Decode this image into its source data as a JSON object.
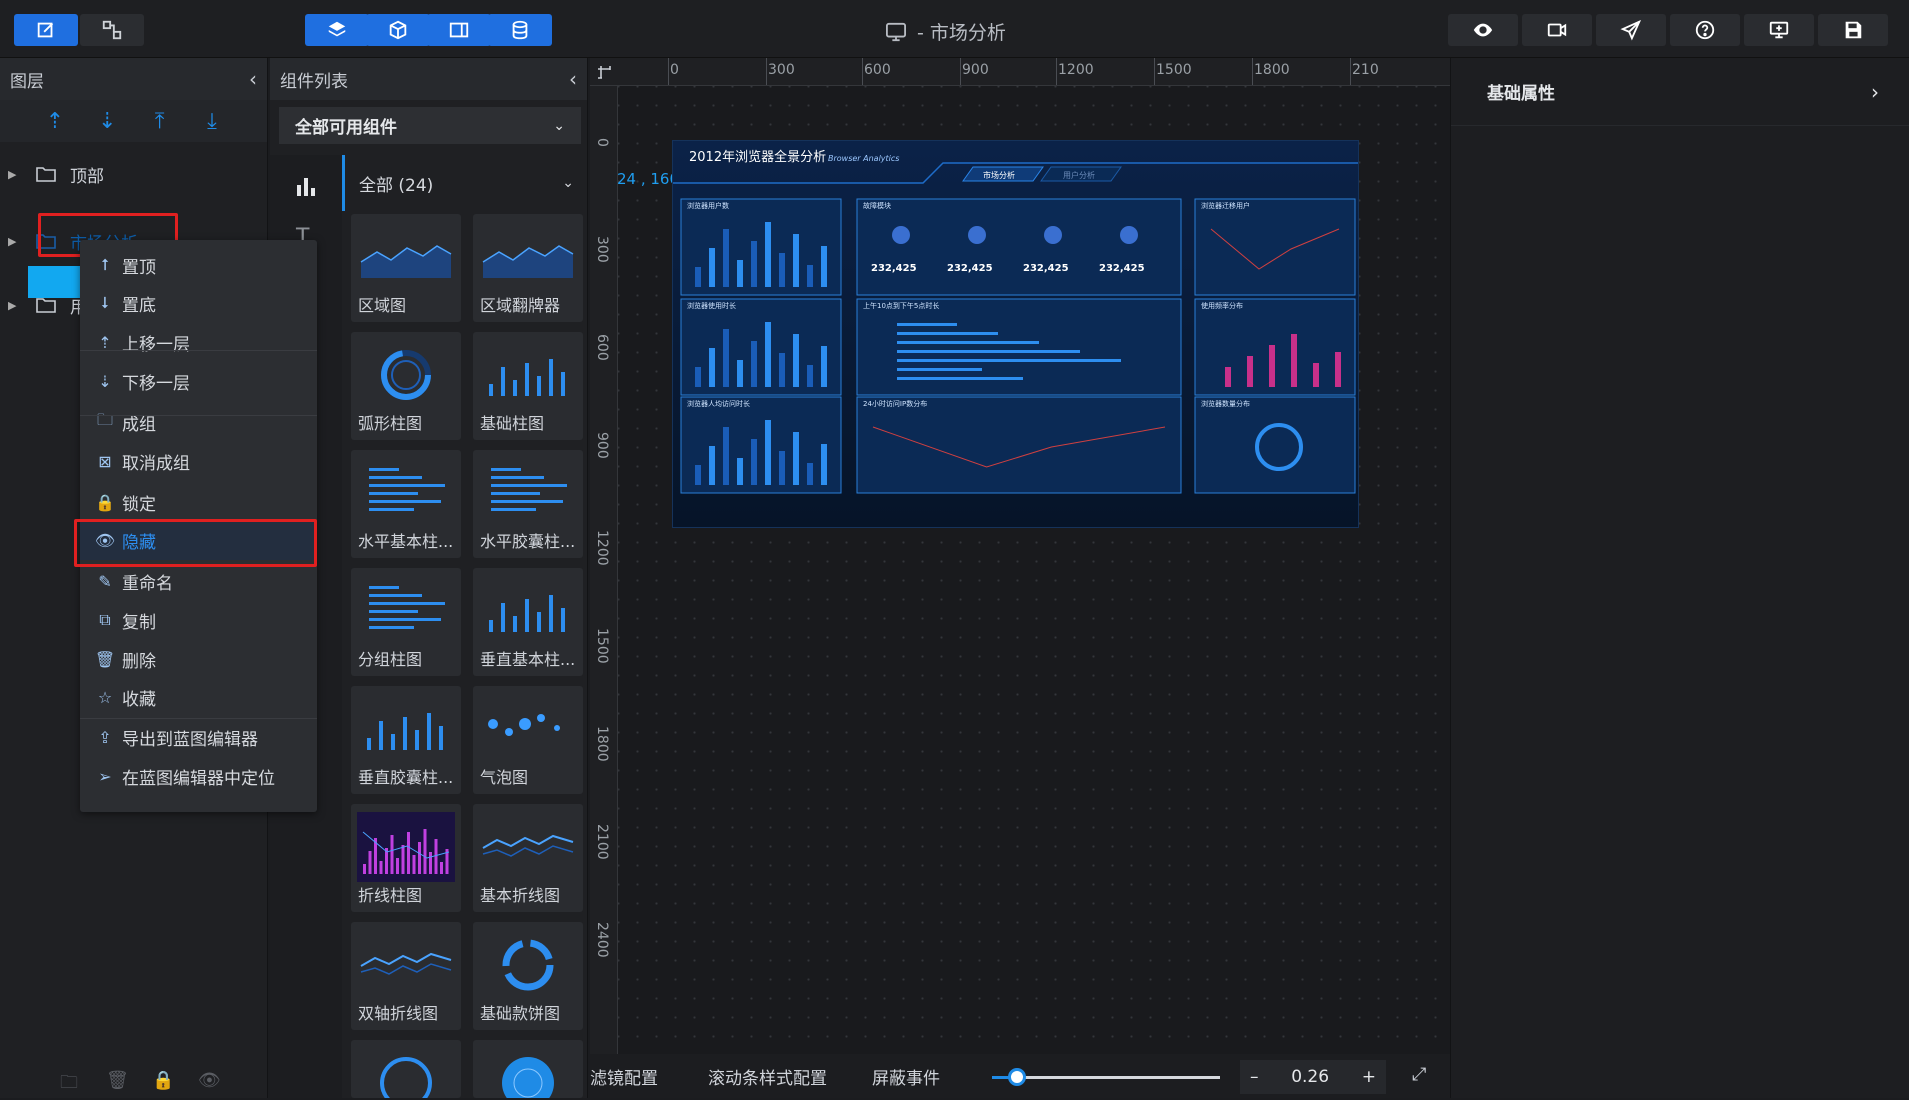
{
  "toolbar": {
    "title": "- 市场分析",
    "left_buttons": [
      "edit-icon",
      "flow-icon"
    ],
    "center_buttons": [
      "layers-icon",
      "cube-icon",
      "panel-icon",
      "database-icon"
    ],
    "right_buttons": [
      "eye-icon",
      "record-icon",
      "send-icon",
      "help-icon",
      "monitor-icon",
      "save-icon"
    ]
  },
  "layer_panel": {
    "title": "图层",
    "items": [
      {
        "label": "顶部"
      },
      {
        "label": "市场分析"
      },
      {
        "label": "用"
      }
    ]
  },
  "context_menu": {
    "items": [
      {
        "label": "置顶",
        "icon": "arrow-up-icon"
      },
      {
        "label": "置底",
        "icon": "arrow-down-icon"
      },
      {
        "label": "上移一层",
        "icon": "move-up-icon"
      },
      {
        "label": "下移一层",
        "icon": "move-down-icon"
      },
      {
        "label": "成组",
        "icon": "folder-icon"
      },
      {
        "label": "取消成组",
        "icon": "ungroup-icon"
      },
      {
        "label": "锁定",
        "icon": "lock-icon"
      },
      {
        "label": "隐藏",
        "icon": "eye-icon"
      },
      {
        "label": "重命名",
        "icon": "pen-icon"
      },
      {
        "label": "复制",
        "icon": "copy-icon"
      },
      {
        "label": "删除",
        "icon": "trash-icon"
      },
      {
        "label": "收藏",
        "icon": "star-icon"
      },
      {
        "label": "导出到蓝图编辑器",
        "icon": "export-icon"
      },
      {
        "label": "在蓝图编辑器中定位",
        "icon": "locate-icon"
      }
    ]
  },
  "component_panel": {
    "title": "组件列表",
    "filter": "全部可用组件",
    "category": "全部 (24)",
    "components": [
      {
        "label": "区域图"
      },
      {
        "label": "区域翻牌器"
      },
      {
        "label": "弧形柱图"
      },
      {
        "label": "基础柱图"
      },
      {
        "label": "水平基本柱..."
      },
      {
        "label": "水平胶囊柱..."
      },
      {
        "label": "分组柱图"
      },
      {
        "label": "垂直基本柱..."
      },
      {
        "label": "垂直胶囊柱..."
      },
      {
        "label": "气泡图"
      },
      {
        "label": "折线柱图"
      },
      {
        "label": "基本折线图"
      },
      {
        "label": "双轴折线图"
      },
      {
        "label": "基础款饼图"
      }
    ]
  },
  "canvas": {
    "ruler_h": [
      "0",
      "300",
      "600",
      "900",
      "1200",
      "1500",
      "1800",
      "210"
    ],
    "ruler_v": [
      "0",
      "300",
      "600",
      "900",
      "1200",
      "1500",
      "1800",
      "2100",
      "2400"
    ],
    "coord": "24 , 160",
    "dashboard": {
      "title": "2012年浏览器全景分析",
      "subtitle": "Browser Analytics",
      "tabs": [
        "市场分析",
        "用户分析"
      ],
      "panels": [
        "浏览器用户数",
        "故障模块",
        "浏览器迁移用户",
        "浏览器使用时长",
        "上午10点到下午5点时长",
        "使用频率分布",
        "浏览器人均访问时长",
        "24小时访问IP数分布",
        "浏览器数量分布"
      ],
      "kpis": [
        "232,425",
        "232,425",
        "232,425",
        "232,425"
      ]
    }
  },
  "bottom_bar": {
    "tabs": [
      "滤镜配置",
      "滚动条样式配置",
      "屏蔽事件"
    ],
    "zoom": 0.26,
    "zoom_label": "0.26"
  },
  "right_panel": {
    "title": "基础属性"
  },
  "colors": {
    "accent": "#1f6fe0",
    "selected": "#12a8f0",
    "highlight": "#e02020"
  }
}
